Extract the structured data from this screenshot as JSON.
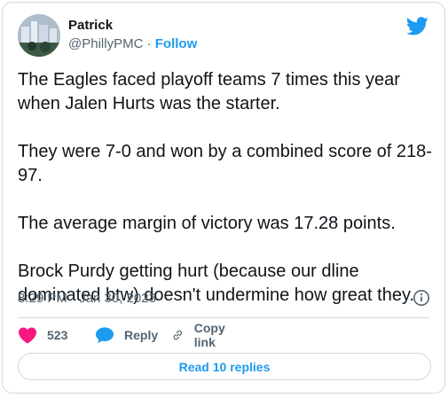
{
  "author": {
    "display_name": "Patrick",
    "handle": "@PhillyPMC",
    "separator": " · ",
    "follow_label": "Follow"
  },
  "tweet": {
    "paragraphs": [
      "The Eagles faced playoff teams 7 times this year when Jalen Hurts was the starter.",
      "They were 7-0 and won by a combined score of 218-97.",
      "The average margin of victory was 17.28 points.",
      "Brock Purdy getting hurt (because our dline dominated btw) doesn't undermine how great they."
    ],
    "timestamp": "8:29 PM · Jan 30, 2023"
  },
  "actions": {
    "likes_count": "523",
    "reply_label": "Reply",
    "copy_link_label": "Copy link"
  },
  "replies_button": "Read 10 replies",
  "icons": {
    "brand": "twitter-bird-icon",
    "info": "info-icon",
    "like": "heart-icon",
    "reply": "speech-bubble-icon",
    "copy": "link-icon"
  },
  "colors": {
    "accent": "#1d9bf0",
    "like": "#f91880",
    "text": "#0f1419",
    "secondary": "#536471",
    "border": "#cfd9de"
  }
}
